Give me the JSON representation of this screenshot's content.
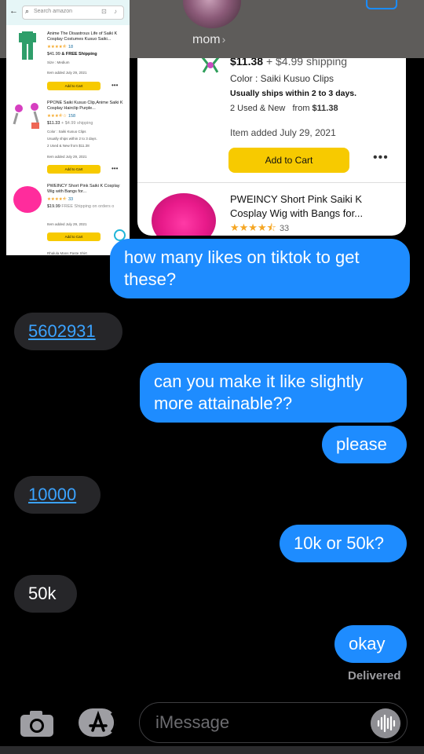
{
  "header": {
    "contact_name": "mom"
  },
  "attachment": {
    "price": "$11.38",
    "shipping": "+ $4.99 shipping",
    "color": "Color : Saiki Kusuo Clips",
    "ship_time": "Usually ships within 2 to 3 days.",
    "used_new": "2 Used & New",
    "from": "from",
    "from_price": "$11.38",
    "item_added": "Item added July 29, 2021",
    "add_to_cart": "Add to Cart",
    "title2": "PWEINCY Short Pink Saiki K Cosplay Wig with Bangs for...",
    "rating_count2": "33",
    "rating2": 4.5
  },
  "amazon_overlay": {
    "search_placeholder": "Search amazon",
    "items": [
      {
        "title": "Anime The Disastrous Life of Saiki K Cosplay Costumes Kusuo Saiki...",
        "rating_count": "18",
        "price": "$41.99",
        "shipping": "& FREE Shipping",
        "size": "Size : Medium",
        "added": "Item added July 29, 2021",
        "btn": "Add to Cart"
      },
      {
        "title": "PPONE Saiki Kusuo Clip,Anime Saiki K Cosplay Hairclip Purple...",
        "rating_count": "158",
        "price": "$11.33",
        "shipping": "+ $4.99 shipping",
        "color": "Color : Saiki Kusuo Clips",
        "ship_time": "Usually ships within 2 to 3 days.",
        "used": "2 Used & New   from $11.38",
        "added": "Item added July 29, 2021",
        "btn": "Add to Cart"
      },
      {
        "title": "PWEINCY Short Pink Saiki K Cosplay Wig with Bangs for...",
        "rating_count": "33",
        "price": "$19.99",
        "shipping": "FREE Shipping on orders o",
        "added": "Item added July 29, 2021",
        "btn": "Add to Cart"
      }
    ],
    "next_item": "Rhalula Mans Paste Shirt"
  },
  "messages": [
    {
      "dir": "out",
      "text": "how many likes on tiktok to get these?"
    },
    {
      "dir": "in",
      "text": "5602931"
    },
    {
      "dir": "out",
      "text": "can you make it like slightly more attainable??"
    },
    {
      "dir": "out",
      "text": "please"
    },
    {
      "dir": "in",
      "text": "10000"
    },
    {
      "dir": "out",
      "text": "10k or 50k?"
    },
    {
      "dir": "in",
      "text": "50k"
    },
    {
      "dir": "out",
      "text": "okay"
    }
  ],
  "status": {
    "delivered": "Delivered"
  },
  "composer": {
    "placeholder": "iMessage"
  },
  "colors": {
    "outgoing": "#1e8cff",
    "incoming": "#262629",
    "link": "#3ba3ff"
  }
}
